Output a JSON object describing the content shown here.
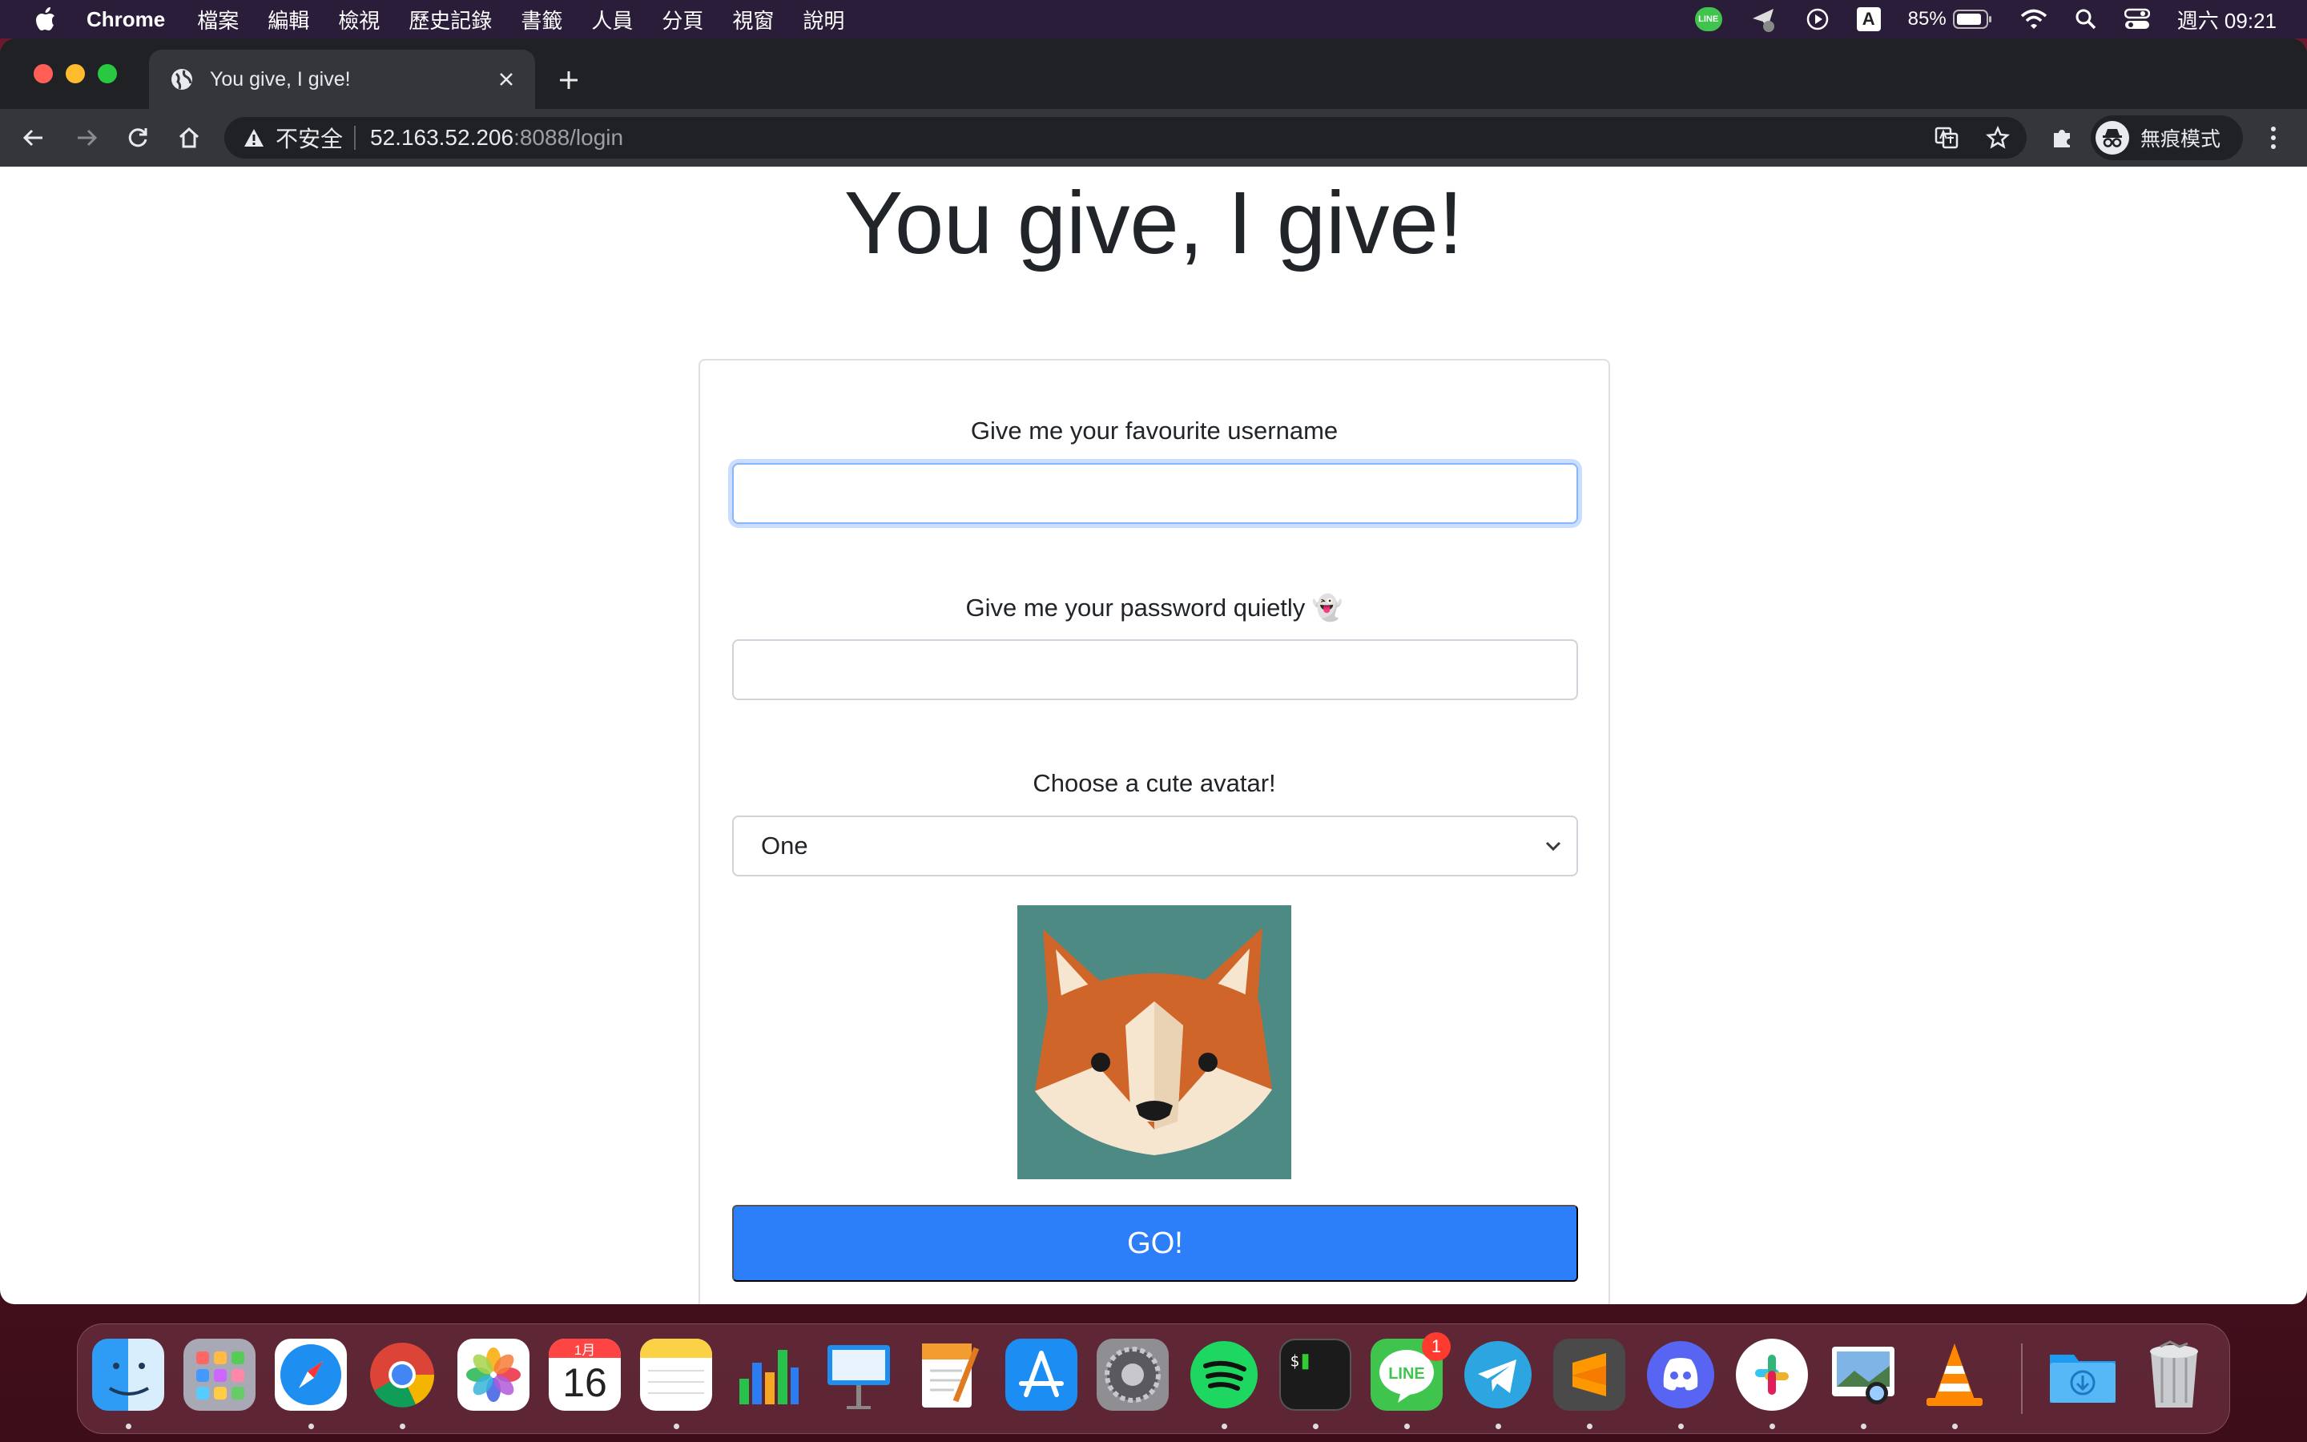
{
  "menubar": {
    "app_name": "Chrome",
    "items": [
      "檔案",
      "編輯",
      "檢視",
      "歷史記錄",
      "書籤",
      "人員",
      "分頁",
      "視窗",
      "說明"
    ],
    "status": {
      "line_label": "LINE",
      "input_source": "A",
      "battery": "85%",
      "clock": "週六 09:21"
    }
  },
  "browser": {
    "tab_title": "You give, I give!",
    "omnibox": {
      "security_label": "不安全",
      "host": "52.163.52.206",
      "path": ":8088/login"
    },
    "profile_label": "無痕模式"
  },
  "page": {
    "heading": "You give, I give!",
    "form": {
      "username_label": "Give me your favourite username",
      "username_value": "",
      "password_label": "Give me your password quietly 👻",
      "password_value": "",
      "avatar_label": "Choose a cute avatar!",
      "avatar_selected": "One",
      "submit_label": "GO!"
    }
  },
  "dock": {
    "calendar_month": "1月",
    "calendar_day": "16",
    "line_badge": "1",
    "apps": [
      "finder",
      "launchpad",
      "safari",
      "chrome",
      "photos",
      "calendar",
      "notes",
      "numbers",
      "keynote",
      "pages",
      "app-store",
      "system-preferences",
      "spotify",
      "terminal",
      "line",
      "telegram",
      "sublime-text",
      "discord",
      "slack",
      "preview",
      "vlc",
      "downloads",
      "trash"
    ]
  },
  "colors": {
    "menubar_bg": "#2a1d3a",
    "chrome_dark": "#202124",
    "chrome_toolbar": "#35363a",
    "primary_button": "#2d7ff9",
    "avatar_bg": "#4d8a84"
  }
}
